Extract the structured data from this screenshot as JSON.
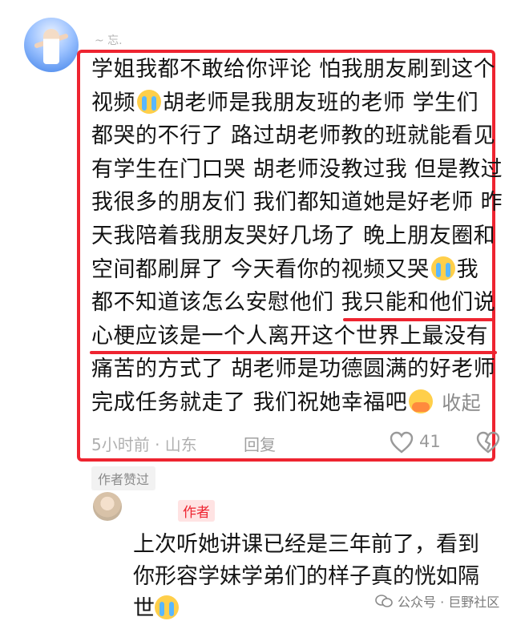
{
  "comment": {
    "username": "~ 忘.",
    "lines": [
      "学姐我都不敢给你评论 怕我朋友刷到这个",
      "视频",
      "胡老师是我朋友班的老师 学生们",
      "都哭的不行了 路过胡老师教的班就能看见",
      "有学生在门口哭 胡老师没教过我 但是教过",
      "我很多的朋友们 我们都知道她是好老师 昨",
      "天我陪着我朋友哭好几场了 晚上朋友圈和",
      "空间都刷屏了 今天看你的视频又哭",
      "我",
      "都不知道该怎么安慰他们 我只能和他们说",
      "心梗应该是一个人离开这个世界上最没有",
      "痛苦的方式了 胡老师是功德圆满的好老师",
      "完成任务就走了 我们祝她幸福吧"
    ],
    "collapse_label": "收起",
    "time_location": "5小时前 · 山东",
    "reply_label": "回复",
    "like_count": "41",
    "author_liked_badge": "作者赞过"
  },
  "reply": {
    "author_tag": "作者",
    "lines": [
      "上次听她讲课已经是三年前了，看到",
      "你形容学妹学弟们的样子真的恍如隔",
      "世"
    ]
  },
  "watermark": {
    "text": "公众号 · 巨野社区"
  },
  "icons": {
    "cry_emoji": "loudly-crying-face",
    "hug_emoji": "hugging-face",
    "like": "heart-outline",
    "dislike": "broken-heart-outline"
  },
  "colors": {
    "highlight_border": "#ee2430",
    "underline": "#ee2430",
    "meta_text": "#b0b0b0"
  }
}
